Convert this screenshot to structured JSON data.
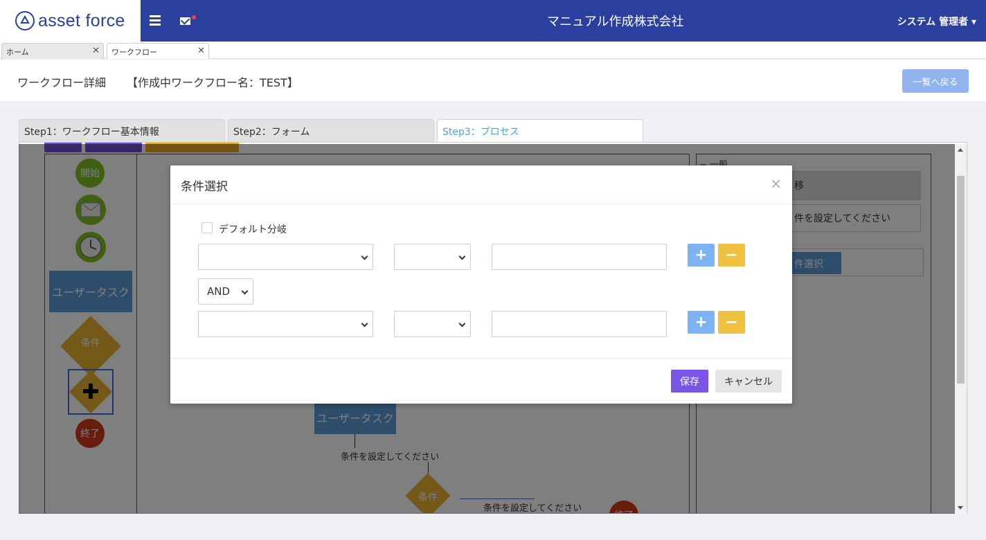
{
  "header": {
    "logo_text": "asset force",
    "company_name": "マニュアル作成株式会社",
    "user_name": "システム 管理者"
  },
  "page_tabs": [
    {
      "label": "ホーム"
    },
    {
      "label": "ワークフロー"
    }
  ],
  "page": {
    "title": "ワークフロー詳細",
    "workflow_name": "【作成中ワークフロー名：TEST】",
    "back_label": "一覧へ戻る"
  },
  "steps": [
    {
      "label": "Step1：ワークフロー基本情報"
    },
    {
      "label": "Step2：フォーム"
    },
    {
      "label": "Step3：プロセス"
    }
  ],
  "palette": {
    "start": "開始",
    "user_task": "ユーザータスク",
    "condition": "条件",
    "end": "終了"
  },
  "canvas": {
    "user_task": "ユーザータスク",
    "condition_note_1": "条件を設定してください",
    "condition": "条件",
    "condition_note_2": "条件を設定してください",
    "end": "終了"
  },
  "props_panel": {
    "section": "一般",
    "field1": "移",
    "field2": "件を設定してください",
    "button": "件選択"
  },
  "modal": {
    "title": "条件選択",
    "close": "×",
    "default_branch_label": "デフォルト分岐",
    "logic_operator": "AND",
    "save_label": "保存",
    "cancel_label": "キャンセル",
    "plus": "+",
    "minus": "−"
  },
  "colors": {
    "header_bg": "#2a3f9e",
    "save": "#7a55e8",
    "plus": "#7db3f3",
    "minus": "#f0c040"
  }
}
